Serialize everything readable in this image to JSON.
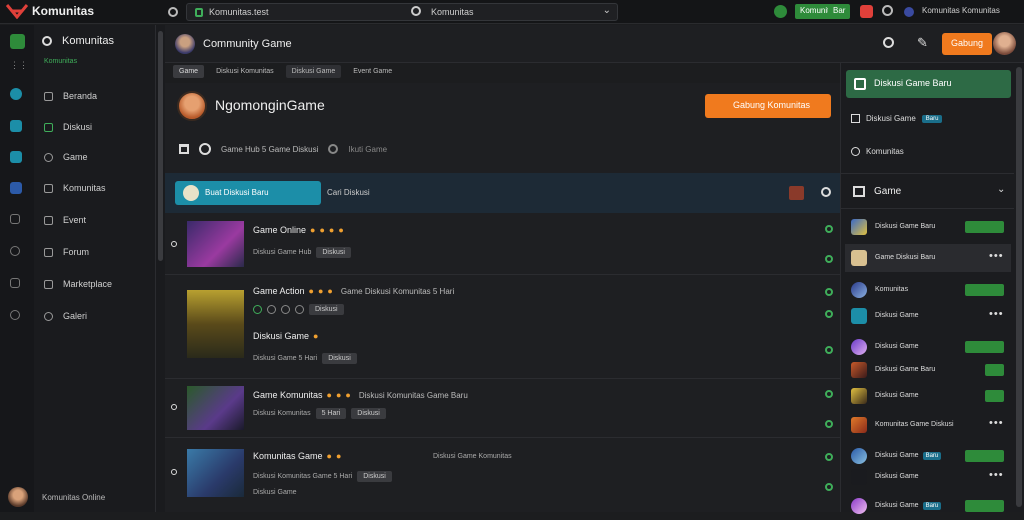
{
  "app": {
    "title": "Komunitas"
  },
  "addressbar": {
    "url": "Komunitas.test",
    "search": "Komunitas"
  },
  "topbar": {
    "btn1": "Komunitas",
    "btn2": "Bar",
    "user": "Komunitas Komunitas",
    "colors": {
      "accent": "#2e8b3a"
    }
  },
  "nav": {
    "brand": "Komunitas",
    "brand_sub": "Komunitas",
    "items": [
      {
        "label": "Beranda"
      },
      {
        "label": "Diskusi"
      },
      {
        "label": "Game"
      },
      {
        "label": "Komunitas"
      },
      {
        "label": "Event"
      },
      {
        "label": "Forum"
      },
      {
        "label": "Marketplace"
      },
      {
        "label": "Galeri"
      }
    ],
    "footer": "Komunitas Online"
  },
  "header": {
    "title": "Community Game",
    "cta": "Gabung"
  },
  "tabs": [
    {
      "label": "Game"
    },
    {
      "label": "Diskusi Komunitas"
    },
    {
      "label": "Diskusi Game"
    },
    {
      "label": "Event Game"
    }
  ],
  "group": {
    "name": "NgomonginGame",
    "join": "Gabung Komunitas",
    "meta": "Game Hub 5 Game Diskusi",
    "meta_dim": "Ikuti Game"
  },
  "feed": {
    "button": "Buat Diskusi Baru",
    "sub": "Cari Diskusi"
  },
  "posts": [
    {
      "title": "Game Online",
      "extra": "",
      "info": "Diskusi Game Hub",
      "chip": "Diskusi"
    },
    {
      "title": "Game Action",
      "extra": "Game Diskusi Komunitas 5 Hari",
      "info": "",
      "chip": "Diskusi"
    },
    {
      "title": "Diskusi Game",
      "extra": "",
      "info": "Diskusi Game 5 Hari",
      "chip": "Diskusi"
    },
    {
      "title": "Game Komunitas",
      "extra": "Diskusi Komunitas Game Baru",
      "info": "Diskusi Komunitas",
      "chip": "Diskusi",
      "chip2": "5 Hari"
    },
    {
      "title": "Komunitas Game",
      "extra": "Diskusi Game Komunitas",
      "info": "Diskusi Komunitas Game 5 Hari",
      "chip": "Diskusi",
      "info2": "Diskusi Game"
    }
  ],
  "side": {
    "top": "Diskusi Game Baru",
    "row1": "Diskusi Game",
    "row1_pill": "Baru",
    "row2": "Komunitas",
    "list_title": "Game",
    "list": [
      {
        "name": "Diskusi Game Baru"
      },
      {
        "name": "Game Diskusi Baru"
      },
      {
        "name": "Komunitas"
      },
      {
        "name": "Diskusi Game"
      },
      {
        "name": "Diskusi Game"
      },
      {
        "name": "Diskusi Game Baru"
      },
      {
        "name": "Diskusi Game"
      },
      {
        "name": "Komunitas Game Diskusi"
      },
      {
        "name": "Diskusi Game",
        "pill": "Baru"
      },
      {
        "name": "Diskusi Game"
      },
      {
        "name": "Diskusi Game",
        "pill": "Baru"
      }
    ]
  }
}
